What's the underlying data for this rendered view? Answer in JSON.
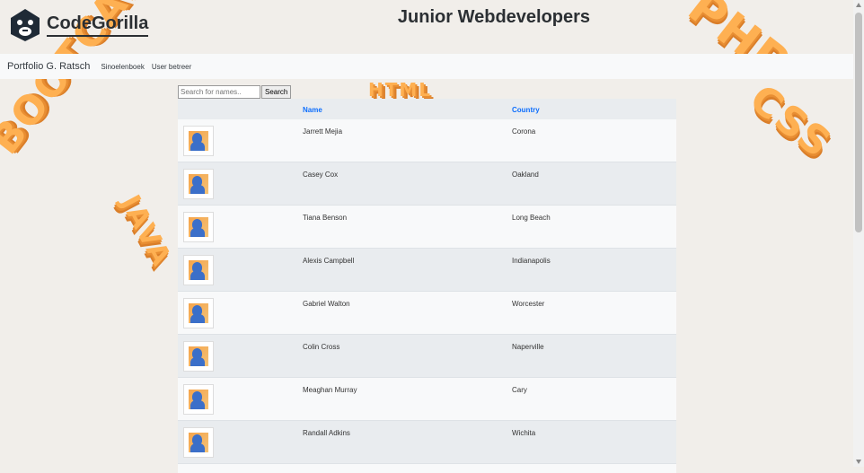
{
  "decoration": {
    "text1": "BOOTCAMP",
    "text2": "JAVA",
    "text3": "HTML",
    "text4": "PHP",
    "text5": "CSS"
  },
  "header": {
    "logo_text": "CodeGorilla",
    "title": "Junior Webdevelopers"
  },
  "nav": {
    "brand": "Portfolio G. Ratsch",
    "links": [
      "Sinoelenboek",
      "User betreer"
    ]
  },
  "search": {
    "placeholder": "Search for names..",
    "button_label": "Search"
  },
  "table": {
    "columns": [
      "Name",
      "Country"
    ],
    "rows": [
      {
        "name": "Jarrett Mejia",
        "country": "Corona"
      },
      {
        "name": "Casey Cox",
        "country": "Oakland"
      },
      {
        "name": "Tiana Benson",
        "country": "Long Beach"
      },
      {
        "name": "Alexis Campbell",
        "country": "Indianapolis"
      },
      {
        "name": "Gabriel Walton",
        "country": "Worcester"
      },
      {
        "name": "Colin Cross",
        "country": "Naperville"
      },
      {
        "name": "Meaghan Murray",
        "country": "Cary"
      },
      {
        "name": "Randall Adkins",
        "country": "Wichita"
      }
    ]
  },
  "icons": {
    "logo": "gorilla-icon",
    "avatar": "user-avatar-icon"
  },
  "colors": {
    "accent": "#0d6efd",
    "decoration": "#ffad4a"
  }
}
